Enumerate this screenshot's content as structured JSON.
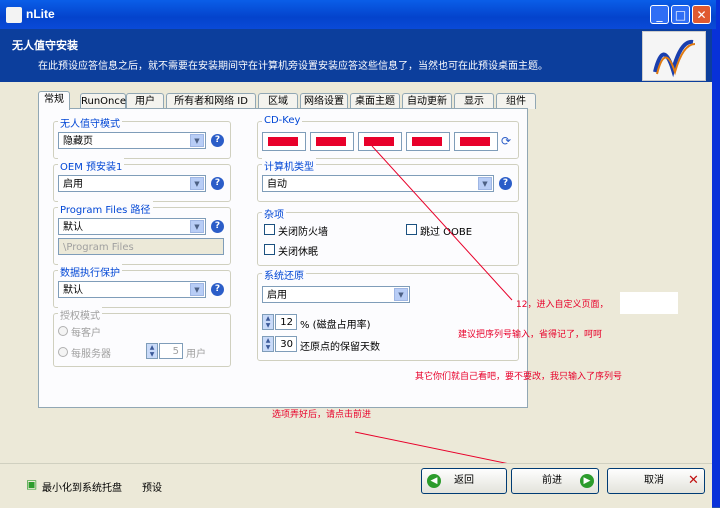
{
  "window": {
    "title": "nLite",
    "minimize": "_",
    "maximize": "□",
    "close": "✕"
  },
  "header": {
    "title": "无人值守安装",
    "subtitle": "在此预设应答信息之后，就不需要在安装期间守在计算机旁设置安装应答这些信息了，当然也可在此预设桌面主题。"
  },
  "tabs": [
    "常规",
    "RunOnce",
    "用户",
    "所有者和网络 ID",
    "区域",
    "网络设置",
    "桌面主题",
    "自动更新",
    "显示",
    "组件"
  ],
  "unattended": {
    "label": "无人值守模式",
    "value": "隐藏页"
  },
  "oem": {
    "label": "OEM 预安装1",
    "value": "启用"
  },
  "program_files": {
    "label": "Program Files 路径",
    "value": "默认",
    "path_placeholder": "\\Program Files"
  },
  "dep": {
    "label": "数据执行保护",
    "value": "默认"
  },
  "licensing": {
    "label": "授权模式",
    "per_seat": "每客户",
    "per_server": "每服务器",
    "count": "5",
    "users": "用户"
  },
  "cdkey": {
    "label": "CD-Key"
  },
  "computer_type": {
    "label": "计算机类型",
    "value": "自动"
  },
  "misc": {
    "label": "杂项",
    "firewall": "关闭防火墙",
    "skip_oobe": "跳过 OOBE",
    "hibernate": "关闭休眠"
  },
  "restore": {
    "label": "系统还原",
    "value": "启用",
    "disk_value": "12",
    "disk_label": "% (磁盘占用率)",
    "days_value": "30",
    "days_label": "还原点的保留天数"
  },
  "bottom": {
    "tray": "最小化到系统托盘",
    "preset": "预设",
    "back": "返回",
    "next": "前进",
    "cancel": "取消"
  },
  "annotations": {
    "a1": "12，进入自定义页面，",
    "a2": "建议把序列号输入，省得记了，呵呵",
    "a3": "其它你们就自己看吧，要不要改，我只输入了序列号",
    "a4": "选项弄好后，请点击前进"
  },
  "colors": {
    "annotation": "#e8002a",
    "header_bg": "#0c3e9c",
    "title_bg": "#0a5ee8"
  }
}
